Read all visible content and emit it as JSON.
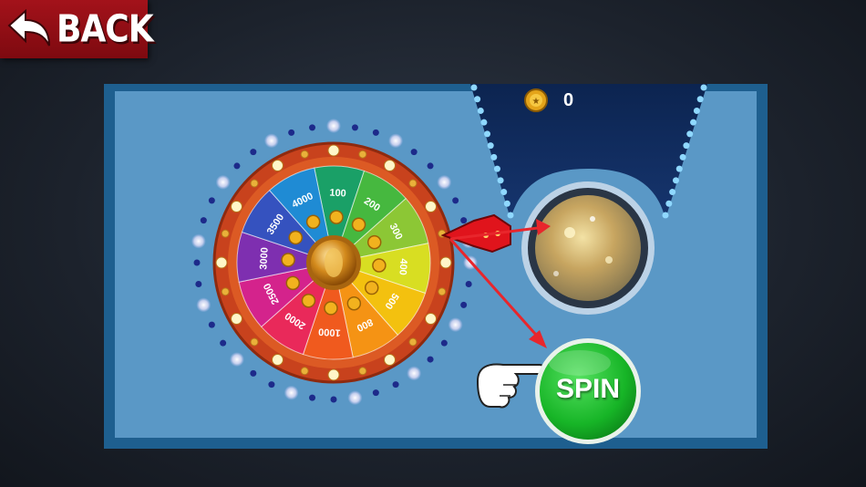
{
  "back_button": {
    "label": "BACK",
    "icon": "arrow-back-icon"
  },
  "coins": {
    "count": "0",
    "icon": "coin-icon"
  },
  "wheel": {
    "segments": [
      {
        "value": "100",
        "color": "#1aa067"
      },
      {
        "value": "200",
        "color": "#46b83f"
      },
      {
        "value": "300",
        "color": "#8cc735"
      },
      {
        "value": "400",
        "color": "#d8de22"
      },
      {
        "value": "500",
        "color": "#f3c10f"
      },
      {
        "value": "800",
        "color": "#f59314"
      },
      {
        "value": "1000",
        "color": "#f05a1e"
      },
      {
        "value": "2000",
        "color": "#e9295a"
      },
      {
        "value": "2500",
        "color": "#d4238c"
      },
      {
        "value": "3000",
        "color": "#7e2fb0"
      },
      {
        "value": "3500",
        "color": "#3552bf"
      },
      {
        "value": "4000",
        "color": "#1f8bd4"
      }
    ]
  },
  "spin_button": {
    "label": "SPIN",
    "color": "#1ebf2f"
  },
  "colors": {
    "panel_border": "#1e5f8f",
    "panel_fill": "#5a98c6",
    "back_button": "#8f0e15"
  }
}
